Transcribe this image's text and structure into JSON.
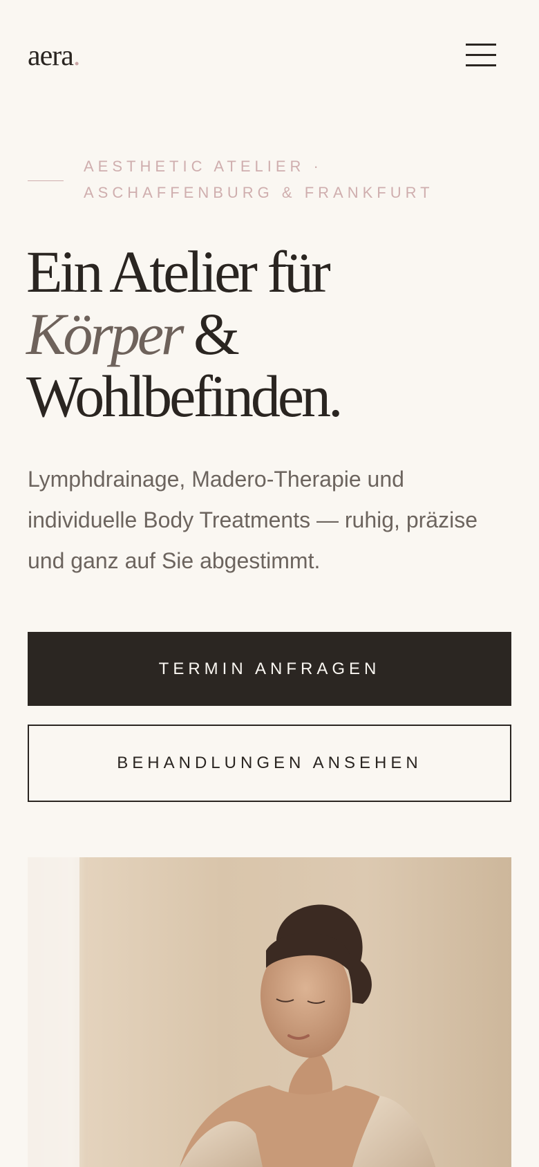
{
  "header": {
    "logo_text": "aera",
    "logo_dot": ".",
    "menu_icon": "hamburger-menu-icon"
  },
  "hero": {
    "eyebrow_line1": "AESTHETIC ATELIER ·",
    "eyebrow_line2": "ASCHAFFENBURG & FRANKFURT",
    "headline_line1": "Ein Atelier für",
    "headline_line2_italic": "Körper",
    "headline_line2_rest": " &",
    "headline_line3": "Wohlbefinden.",
    "lead": "Lymphdrainage, Madero-Therapie und individuelle Body Treatments — ruhig, präzise und ganz auf Sie abgestimmt.",
    "primary_button": "TERMIN ANFRAGEN",
    "secondary_button": "BEHANDLUNGEN ANSEHEN"
  },
  "colors": {
    "background": "#faf7f2",
    "text_dark": "#2a2521",
    "accent_rose": "#cfaeae",
    "body_text": "#6c645e"
  }
}
